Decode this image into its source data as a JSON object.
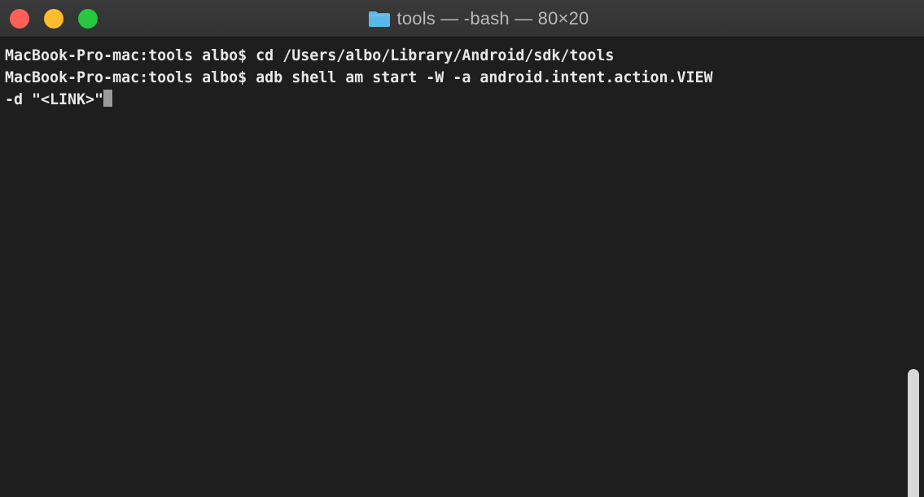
{
  "window": {
    "title": "tools — -bash — 80×20",
    "folder_icon": "folder-icon",
    "colors": {
      "close": "#fe5f57",
      "minimize": "#febc2e",
      "zoom": "#27c840",
      "folder": "#5ab8e8",
      "background": "#1e1e1e",
      "text": "#e8e8e8"
    }
  },
  "terminal": {
    "lines": [
      "MacBook-Pro-mac:tools albo$ cd /Users/albo/Library/Android/sdk/tools",
      "MacBook-Pro-mac:tools albo$ adb shell am start -W -a android.intent.action.VIEW",
      "-d \"<LINK>\""
    ]
  }
}
